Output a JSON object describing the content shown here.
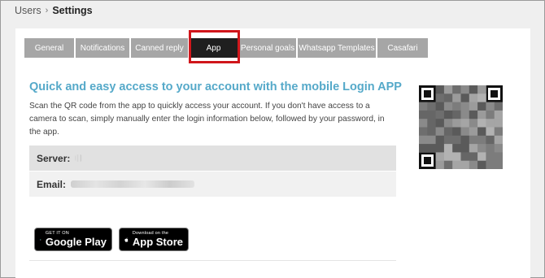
{
  "breadcrumb": {
    "parent": "Users",
    "separator": "›",
    "current": "Settings"
  },
  "tabs": [
    {
      "label": "General",
      "active": false
    },
    {
      "label": "Notifications",
      "active": false
    },
    {
      "label": "Canned reply",
      "active": false
    },
    {
      "label": "App",
      "active": true
    },
    {
      "label": "Personal goals",
      "active": false
    },
    {
      "label": "Whatsapp Templates",
      "active": false
    },
    {
      "label": "Casafari",
      "active": false
    }
  ],
  "app": {
    "title": "Quick and easy access to your account with the mobile Login APP",
    "description": "Scan the QR code from the app to quickly access your account. If you don't have access to a camera to scan, simply manually enter the login information below, followed by your password, in the app."
  },
  "info": {
    "server_label": "Server:",
    "email_label": "Email:"
  },
  "badges": {
    "google_small": "GET IT ON",
    "google_big": "Google Play",
    "apple_small": "Download on the",
    "apple_big": "App Store"
  },
  "colors": {
    "accent": "#55a9c9",
    "tab_inactive": "#a6a6a6",
    "tab_active": "#1f1f1f",
    "highlight": "#d0161b"
  }
}
